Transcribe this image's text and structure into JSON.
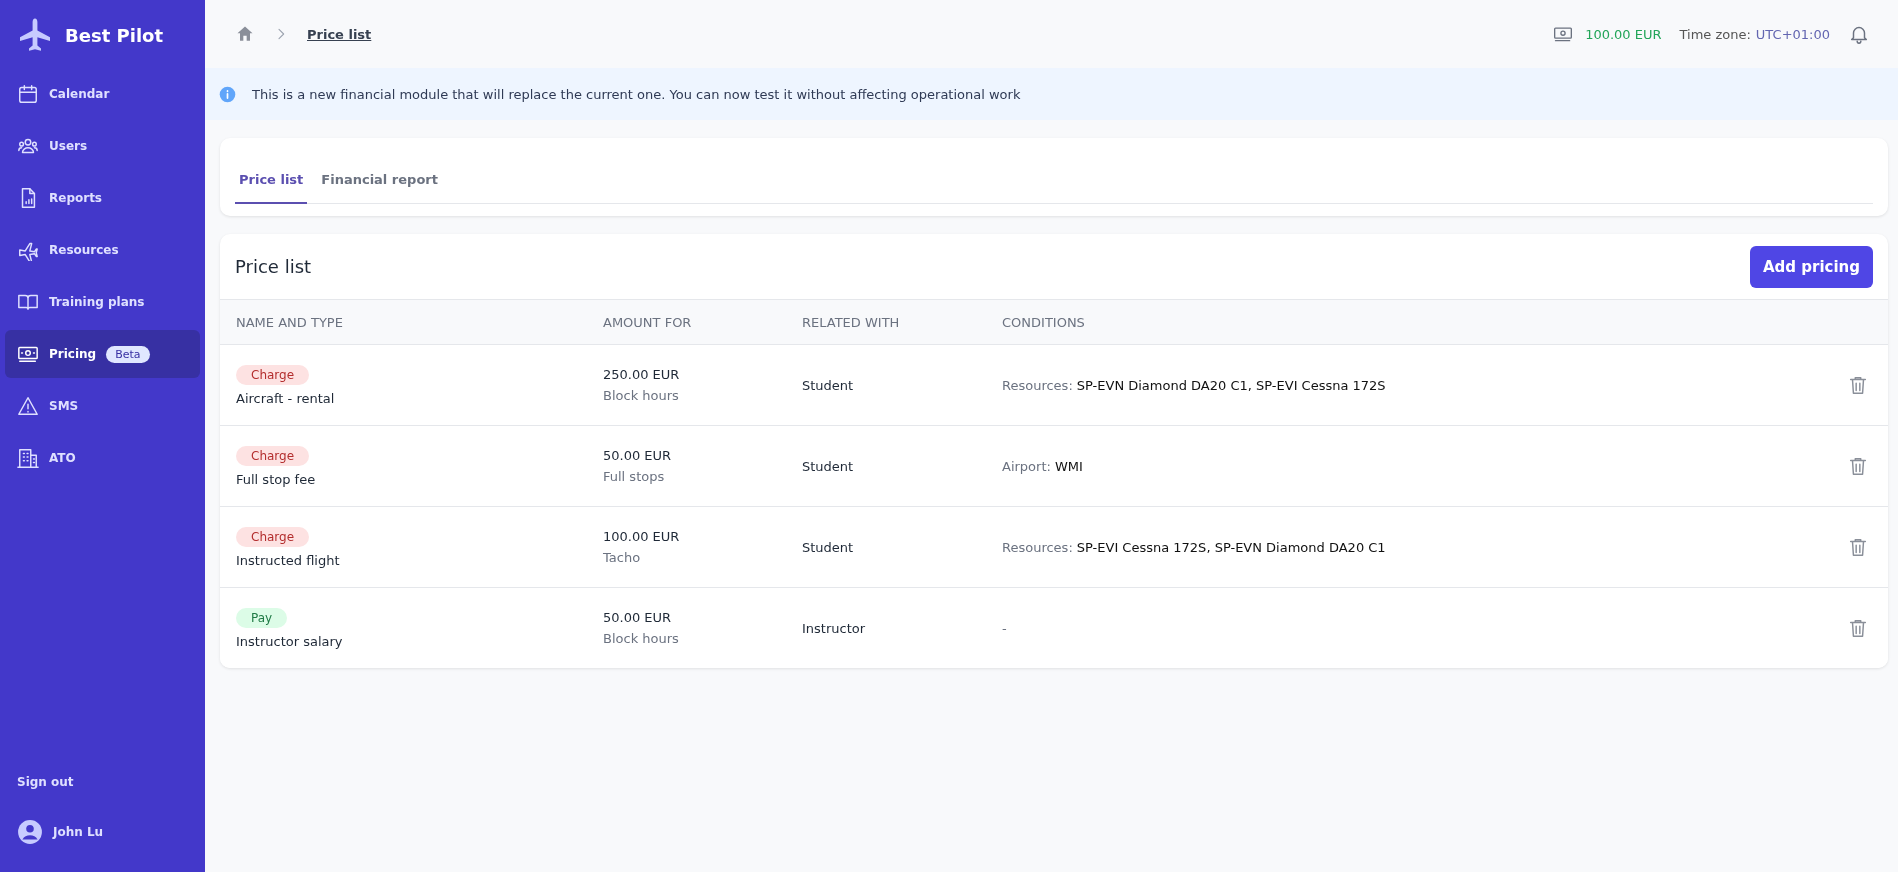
{
  "sidebar": {
    "brand": "Best Pilot",
    "items": [
      {
        "label": "Calendar",
        "selected": false
      },
      {
        "label": "Users",
        "selected": false
      },
      {
        "label": "Reports",
        "selected": false
      },
      {
        "label": "Resources",
        "selected": false
      },
      {
        "label": "Training plans",
        "selected": false
      },
      {
        "label": "Pricing",
        "selected": true,
        "badge": "Beta"
      },
      {
        "label": "SMS",
        "selected": false
      },
      {
        "label": "ATO",
        "selected": false
      }
    ],
    "sign_out": "Sign out",
    "user": "John Lu"
  },
  "header": {
    "breadcrumb": "Price list",
    "balance": "100.00 EUR",
    "timezone_label": "Time zone:",
    "timezone": "UTC+01:00"
  },
  "notice": "This is a new financial module that will replace the current one. You can now test it without affecting operational work",
  "tabs": [
    {
      "label": "Price list",
      "selected": true
    },
    {
      "label": "Financial report",
      "selected": false
    }
  ],
  "price_list": {
    "title": "Price list",
    "add_button": "Add pricing",
    "columns": [
      "NAME AND TYPE",
      "AMOUNT FOR",
      "RELATED WITH",
      "CONDITIONS"
    ],
    "rows": [
      {
        "type": {
          "kind": "charge",
          "label": "Charge"
        },
        "name": "Aircraft - rental",
        "amount": "250.00 EUR",
        "unit": "Block hours",
        "related": "Student",
        "condition_label": "Resources:",
        "condition": "SP-EVN Diamond DA20 C1, SP-EVI Cessna 172S"
      },
      {
        "type": {
          "kind": "charge",
          "label": "Charge"
        },
        "name": "Full stop fee",
        "amount": "50.00 EUR",
        "unit": "Full stops",
        "related": "Student",
        "condition_label": "Airport:",
        "condition": "WMI"
      },
      {
        "type": {
          "kind": "charge",
          "label": "Charge"
        },
        "name": "Instructed flight",
        "amount": "100.00 EUR",
        "unit": "Tacho",
        "related": "Student",
        "condition_label": "Resources:",
        "condition": "SP-EVI Cessna 172S, SP-EVN Diamond DA20 C1"
      },
      {
        "type": {
          "kind": "pay",
          "label": "Pay"
        },
        "name": "Instructor salary",
        "amount": "50.00 EUR",
        "unit": "Block hours",
        "related": "Instructor",
        "no_conditions": "-"
      }
    ]
  }
}
